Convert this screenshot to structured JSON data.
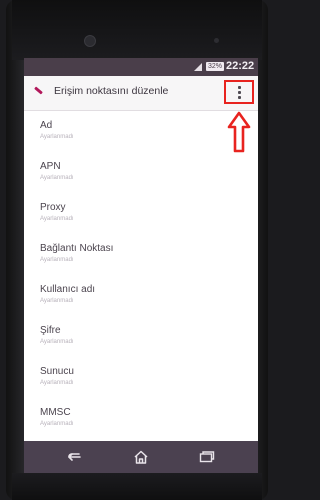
{
  "status_bar": {
    "battery": "32%",
    "time": "22:22"
  },
  "action_bar": {
    "title": "Erişim noktasını düzenle",
    "app_icon": "pencil-icon",
    "menu_icon": "overflow-menu-icon",
    "highlight_color": "#e8231f"
  },
  "fields": [
    {
      "label": "Ad",
      "value": "Ayarlanmadı"
    },
    {
      "label": "APN",
      "value": "Ayarlanmadı"
    },
    {
      "label": "Proxy",
      "value": "Ayarlanmadı"
    },
    {
      "label": "Bağlantı Noktası",
      "value": "Ayarlanmadı"
    },
    {
      "label": "Kullanıcı adı",
      "value": "Ayarlanmadı"
    },
    {
      "label": "Şifre",
      "value": "Ayarlanmadı"
    },
    {
      "label": "Sunucu",
      "value": "Ayarlanmadı"
    },
    {
      "label": "MMSC",
      "value": "Ayarlanmadı"
    }
  ],
  "nav_bar": {
    "back_icon": "back-icon",
    "home_icon": "home-icon",
    "recent_icon": "recent-apps-icon"
  }
}
